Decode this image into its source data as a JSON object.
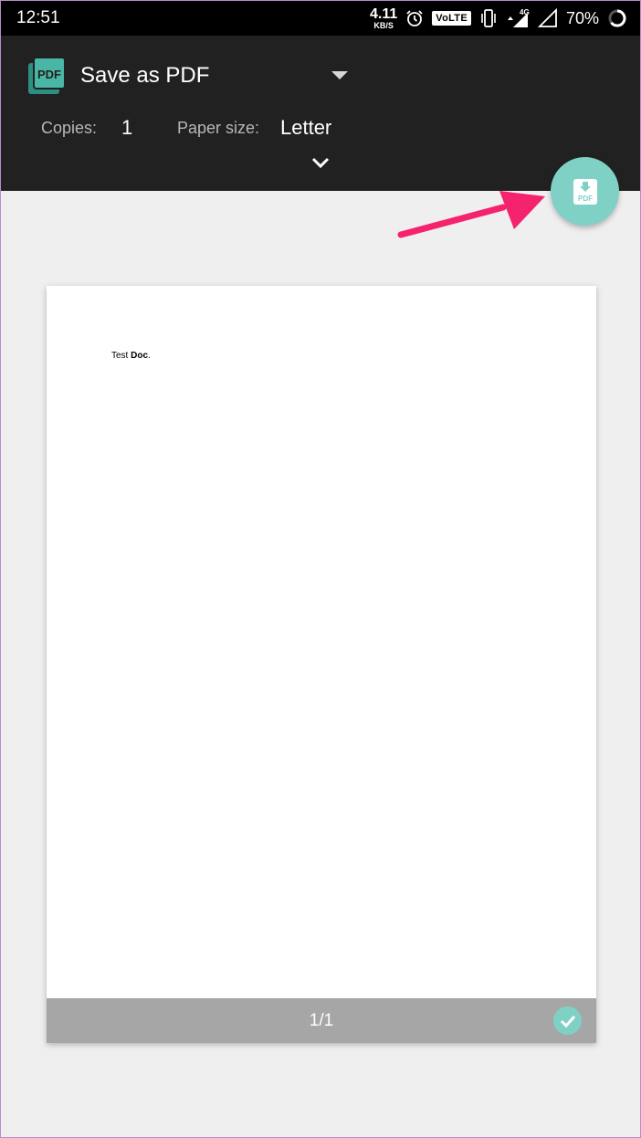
{
  "status_bar": {
    "time": "12:51",
    "net_speed": "4.11",
    "net_speed_unit": "KB/S",
    "volte_label": "VoLTE",
    "network_type": "4G",
    "battery": "70%",
    "icons": [
      "alarm-icon",
      "vibrate-icon",
      "signal-4g-icon",
      "signal-icon",
      "battery-icon"
    ]
  },
  "toolbar": {
    "printer_name": "Save as PDF",
    "copies_label": "Copies:",
    "copies_value": "1",
    "paper_size_label": "Paper size:",
    "paper_size_value": "Letter",
    "background_color": "#212121"
  },
  "fab": {
    "icon": "pdf-download-icon",
    "icon_text": "PDF",
    "color": "#7fd1c6"
  },
  "annotation": {
    "arrow_color": "#f5226e"
  },
  "preview": {
    "doc_text_plain": "Test ",
    "doc_text_bold": "Doc",
    "doc_text_end": ".",
    "page_indicator": "1/1",
    "footer_color": "#a6a6a6"
  }
}
